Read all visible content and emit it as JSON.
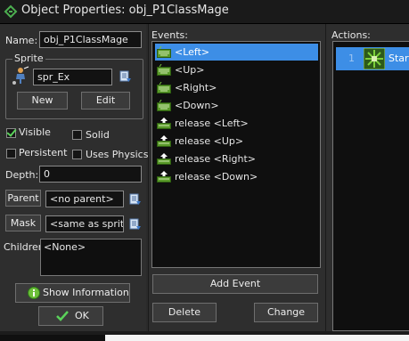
{
  "window": {
    "title": "Object Properties: obj_P1ClassMage"
  },
  "left": {
    "name_label": "Name:",
    "name_value": "obj_P1ClassMage",
    "sprite_group": "Sprite",
    "sprite_value": "spr_Ex",
    "new_label": "New",
    "edit_label": "Edit",
    "visible_label": "Visible",
    "visible_checked": true,
    "solid_label": "Solid",
    "solid_checked": false,
    "persistent_label": "Persistent",
    "persistent_checked": false,
    "physics_label": "Uses Physics",
    "physics_checked": false,
    "depth_label": "Depth:",
    "depth_value": "0",
    "parent_label": "Parent",
    "parent_value": "<no parent>",
    "mask_label": "Mask",
    "mask_value": "<same as sprite>",
    "children_label": "Children:",
    "children_value": "<None>",
    "show_info_label": "Show Information",
    "ok_label": "OK"
  },
  "events": {
    "header": "Events:",
    "items": [
      {
        "label": "<Left>",
        "icon": "keyboard-icon"
      },
      {
        "label": "<Up>",
        "icon": "keyboard-icon"
      },
      {
        "label": "<Right>",
        "icon": "keyboard-icon"
      },
      {
        "label": "<Down>",
        "icon": "keyboard-icon"
      },
      {
        "label": "release <Left>",
        "icon": "key-release-icon"
      },
      {
        "label": "release <Up>",
        "icon": "key-release-icon"
      },
      {
        "label": "release <Right>",
        "icon": "key-release-icon"
      },
      {
        "label": "release <Down>",
        "icon": "key-release-icon"
      }
    ],
    "selected_index": 0,
    "add_event_label": "Add Event",
    "delete_label": "Delete",
    "change_label": "Change"
  },
  "actions": {
    "header": "Actions:",
    "items": [
      {
        "number": "1",
        "label": "Start M",
        "icon": "start-moving-icon"
      }
    ]
  },
  "colors": {
    "selection": "#3d8ee6",
    "background": "#2e2e2e",
    "field_background": "#121212",
    "check_green": "#5ad25a"
  }
}
